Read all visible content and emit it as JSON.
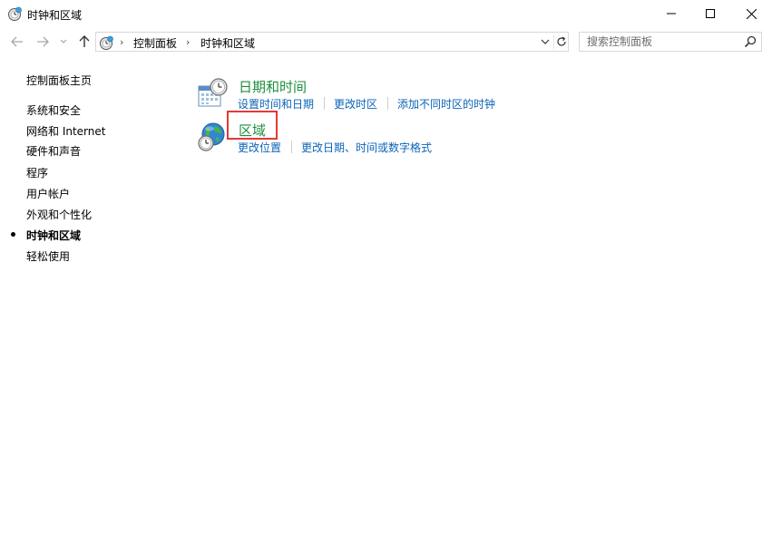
{
  "window": {
    "title": "时钟和区域",
    "icons": {
      "app": "clock-globe-icon",
      "minimize": "minimize-icon",
      "maximize": "maximize-icon",
      "close": "close-icon"
    }
  },
  "nav": {
    "back_icon": "arrow-left-icon",
    "forward_icon": "arrow-right-icon",
    "recent_icon": "chevron-down-icon",
    "up_icon": "arrow-up-icon",
    "breadcrumb": [
      "控制面板",
      "时钟和区域"
    ],
    "refresh_icon": "refresh-icon"
  },
  "search": {
    "placeholder": "搜索控制面板",
    "value": "",
    "icon": "search-icon"
  },
  "sidebar": {
    "home_label": "控制面板主页",
    "items": [
      {
        "label": "系统和安全",
        "active": false
      },
      {
        "label": "网络和 Internet",
        "active": false
      },
      {
        "label": "硬件和声音",
        "active": false
      },
      {
        "label": "程序",
        "active": false
      },
      {
        "label": "用户帐户",
        "active": false
      },
      {
        "label": "外观和个性化",
        "active": false
      },
      {
        "label": "时钟和区域",
        "active": true
      },
      {
        "label": "轻松使用",
        "active": false
      }
    ]
  },
  "categories": [
    {
      "title": "日期和时间",
      "icon": "calendar-clock-icon",
      "links": [
        "设置时间和日期",
        "更改时区",
        "添加不同时区的时钟"
      ]
    },
    {
      "title": "区域",
      "icon": "globe-clock-icon",
      "links": [
        "更改位置",
        "更改日期、时间或数字格式"
      ]
    }
  ],
  "colors": {
    "category_title": "#1e8f3d",
    "task_link": "#0b64b8",
    "highlight_box": "#e53935"
  },
  "highlight": {
    "target": "区域"
  }
}
